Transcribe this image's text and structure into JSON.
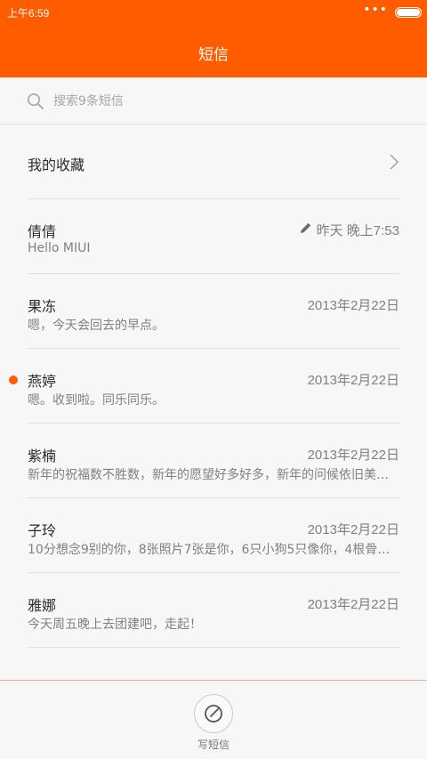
{
  "status": {
    "time": "上午6:59"
  },
  "header": {
    "title": "短信"
  },
  "search": {
    "placeholder": "搜索9条短信"
  },
  "favorites": {
    "label": "我的收藏"
  },
  "conversations": [
    {
      "name": "倩倩",
      "preview": "Hello MIUI",
      "date": "昨天 晚上7:53",
      "draft": true,
      "unread": false
    },
    {
      "name": "果冻",
      "preview": "嗯，今天会回去的早点。",
      "date": "2013年2月22日",
      "draft": false,
      "unread": false
    },
    {
      "name": "燕婷",
      "preview": "嗯。收到啦。同乐同乐。",
      "date": "2013年2月22日",
      "draft": false,
      "unread": true
    },
    {
      "name": "紫楠",
      "preview": "新年的祝福数不胜数，新年的愿望好多好多，新年的问候依旧美…",
      "date": "2013年2月22日",
      "draft": false,
      "unread": false
    },
    {
      "name": "子玲",
      "preview": "10分想念9别的你，8张照片7张是你，6只小狗5只像你，4根骨…",
      "date": "2013年2月22日",
      "draft": false,
      "unread": false
    },
    {
      "name": "雅娜",
      "preview": "今天周五晚上去团建吧，走起！",
      "date": "2013年2月22日",
      "draft": false,
      "unread": false
    }
  ],
  "compose": {
    "label": "写短信"
  },
  "colors": {
    "accent": "#ff5c00",
    "background": "#f7f7f7"
  },
  "icons": {
    "search": "search-icon",
    "chevron": "chevron-right-icon",
    "draft": "pencil-icon",
    "compose": "compose-icon"
  }
}
